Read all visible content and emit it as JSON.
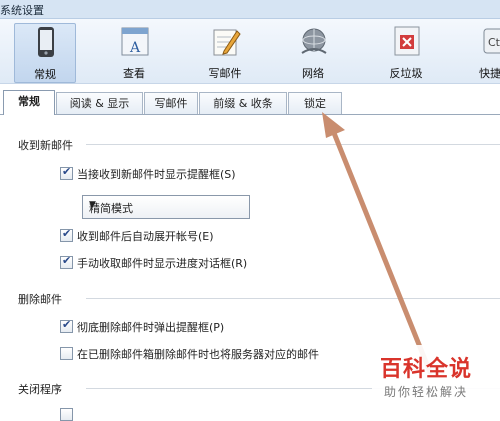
{
  "window": {
    "title": "系统设置"
  },
  "toolbar": {
    "items": [
      {
        "label": "常规",
        "icon": "phone-icon"
      },
      {
        "label": "查看",
        "icon": "view-icon"
      },
      {
        "label": "写邮件",
        "icon": "compose-icon"
      },
      {
        "label": "网络",
        "icon": "network-icon"
      },
      {
        "label": "反垃圾",
        "icon": "antispam-icon"
      },
      {
        "label": "快捷",
        "icon": "shortcut-icon"
      }
    ]
  },
  "tabs": [
    {
      "label": "常规",
      "active": true
    },
    {
      "label": "阅读 & 显示"
    },
    {
      "label": "写邮件"
    },
    {
      "label": "前缀 & 收条"
    },
    {
      "label": "锁定"
    }
  ],
  "sections": {
    "receive": {
      "title": "收到新邮件",
      "show_popup": "当接收到新邮件时显示提醒框(S)",
      "mode_value": "精简模式",
      "auto_expand": "收到邮件后自动展开帐号(E)",
      "manual_progress": "手动收取邮件时显示进度对话框(R)"
    },
    "delete": {
      "title": "删除邮件",
      "confirm_delete": "彻底删除邮件时弹出提醒框(P)",
      "server_delete": "在已删除邮件箱删除邮件时也将服务器对应的邮件"
    },
    "close": {
      "title": "关闭程序"
    }
  },
  "watermark": {
    "brand": "百科全说",
    "slogan": "助你轻松解决"
  },
  "colors": {
    "accent_arrow": "#c98d6f",
    "watermark_red": "#d9342b"
  }
}
